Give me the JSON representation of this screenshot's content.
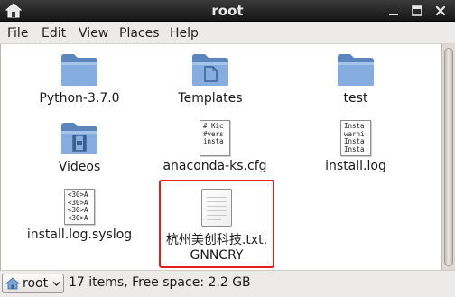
{
  "window": {
    "title": "root"
  },
  "menubar": {
    "items": [
      "File",
      "Edit",
      "View",
      "Places",
      "Help"
    ]
  },
  "files": [
    {
      "name": "Python-3.7.0",
      "kind": "folder"
    },
    {
      "name": "Templates",
      "kind": "folder-templates"
    },
    {
      "name": "test",
      "kind": "folder"
    },
    {
      "name": "Videos",
      "kind": "folder-videos"
    },
    {
      "name": "anaconda-ks.cfg",
      "kind": "text",
      "preview": [
        "# Kic",
        "",
        "#vers",
        "insta"
      ]
    },
    {
      "name": "install.log",
      "kind": "text",
      "preview": [
        "Insta",
        "warni",
        "Insta",
        "Insta"
      ]
    },
    {
      "name": "install.log.syslog",
      "kind": "text",
      "preview": [
        "<30>A",
        "<30>A",
        "<30>A",
        "<30>A"
      ]
    },
    {
      "name_line1": "杭州美创科技.txt.",
      "name_line2": "GNNCRY",
      "kind": "blank",
      "selected": true
    }
  ],
  "statusbar": {
    "location": "root",
    "summary": "17 items, Free space: 2.2 GB"
  },
  "colors": {
    "folder": "#7aa3d6",
    "selection_outline": "#e0201e",
    "titlebar": "#262626"
  },
  "icons": {
    "folder": "folder-icon",
    "home": "home-folder-icon",
    "document": "text-document-icon"
  }
}
